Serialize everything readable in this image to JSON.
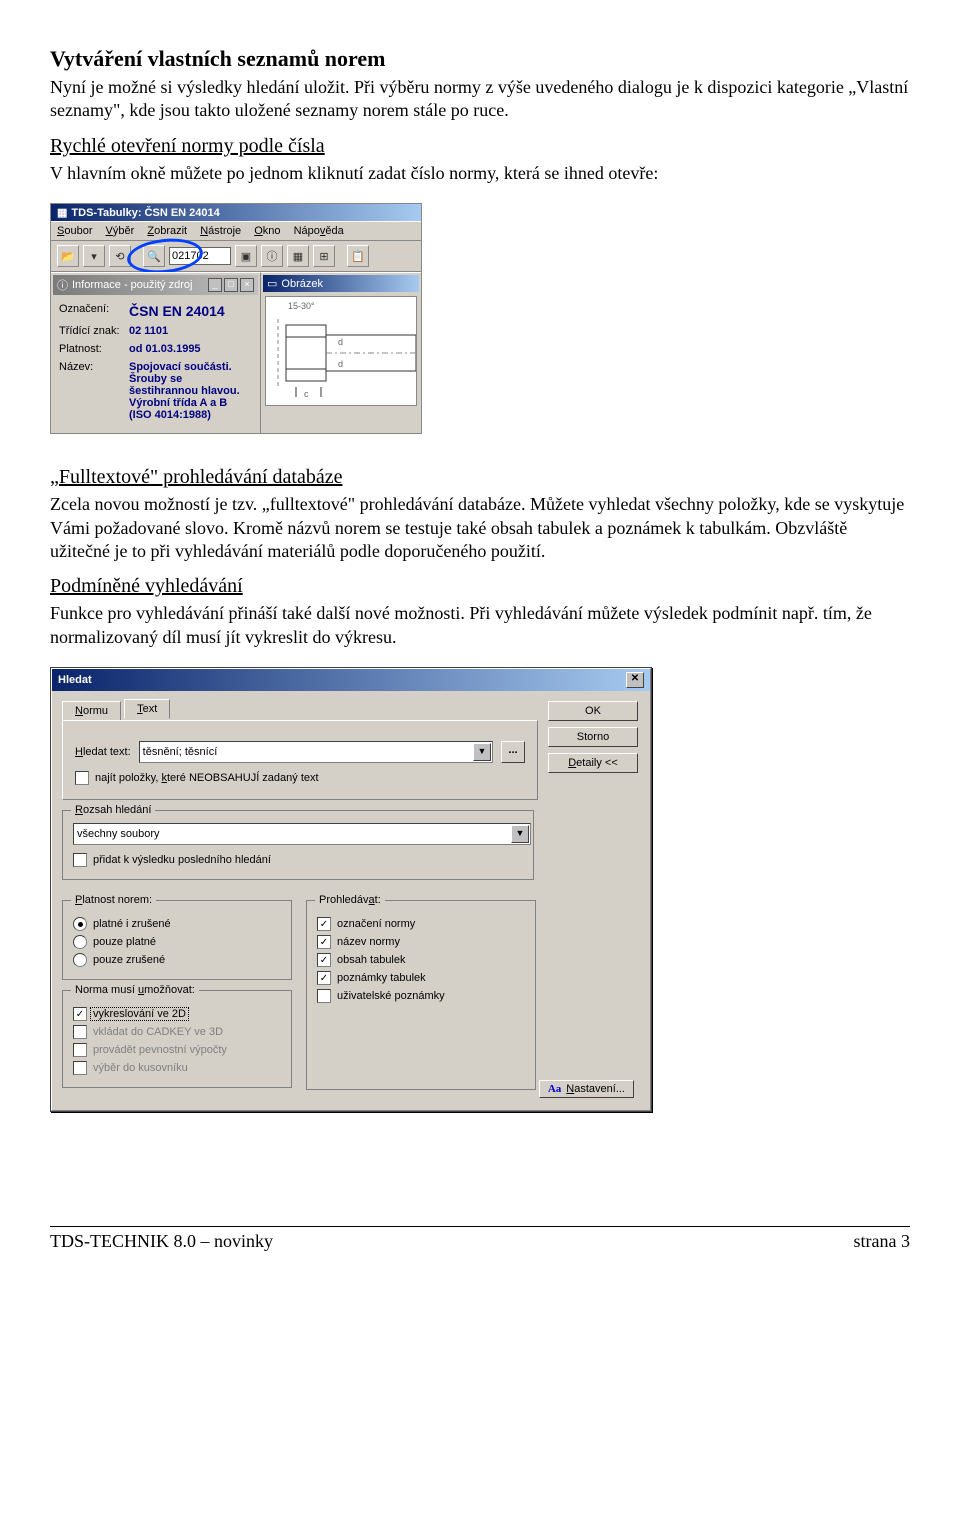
{
  "sections": {
    "s1_heading": "Vytváření vlastních seznamů norem",
    "s1_para": "Nyní je možné si výsledky hledání uložit. Při výběru normy z výše uvedeného dialogu je k dispozici kategorie „Vlastní seznamy\", kde jsou takto uložené seznamy norem stále po ruce.",
    "s2_heading": "Rychlé otevření normy podle čísla",
    "s2_para": "V hlavním okně můžete po jednom kliknutí zadat číslo normy, která se ihned otevře:",
    "s3_heading": "„Fulltextové\" prohledávání databáze",
    "s3_para": "Zcela novou možností je tzv. „fulltextové\" prohledávání databáze. Můžete vyhledat všechny položky, kde se vyskytuje Vámi požadované slovo. Kromě názvů norem se testuje také obsah tabulek a poznámek k tabulkám. Obzvláště užitečné je to při vyhledávání materiálů podle doporučeného použití.",
    "s4_heading": "Podmíněné vyhledávání",
    "s4_para": "Funkce pro vyhledávání přináší také další nové možnosti. Při vyhledávání můžete výsledek podmínit např. tím, že normalizovaný díl musí jít vykreslit do výkresu."
  },
  "app1": {
    "title": "TDS-Tabulky: ČSN EN 24014",
    "menus": [
      "Soubor",
      "Výběr",
      "Zobrazit",
      "Nástroje",
      "Okno",
      "Nápověda"
    ],
    "search_value": "021702",
    "info_panel_title": "Informace - použitý zdroj",
    "rows": {
      "oznaceni_label": "Označení:",
      "oznaceni": "ČSN EN 24014",
      "tridici_label": "Třídící znak:",
      "tridici": "02 1101",
      "platnost_label": "Platnost:",
      "platnost": "od 01.03.1995",
      "nazev_label": "Název:",
      "nazev": "Spojovací součásti. Šrouby se šestihrannou hlavou. Výrobní třída A a B (ISO 4014:1988)"
    },
    "img_panel_title": "Obrázek",
    "angle_label": "15-30°"
  },
  "dlg": {
    "title": "Hledat",
    "tabs": {
      "normu": "Normu",
      "text": "Text"
    },
    "btn_ok": "OK",
    "btn_storno": "Storno",
    "btn_detaily": "Detaily <<",
    "hledat_label": "Hledat text:",
    "hledat_value": "těsnění; těsnící",
    "neobsahuji": "najít položky, které NEOBSAHUJÍ zadaný text",
    "grp_rozsah": "Rozsah hledání",
    "rozsah_value": "všechny soubory",
    "pridat_vysledek": "přidat k výsledku posledního hledání",
    "grp_platnost": "Platnost norem:",
    "radio1": "platné i zrušené",
    "radio2": "pouze platné",
    "radio3": "pouze zrušené",
    "grp_prohledavat": "Prohledávat:",
    "chk_p1": "označení normy",
    "chk_p2": "název normy",
    "chk_p3": "obsah tabulek",
    "chk_p4": "poznámky tabulek",
    "chk_p5": "uživatelské poznámky",
    "grp_norma": "Norma musí umožňovat:",
    "chk_n1": "vykreslování ve 2D",
    "chk_n2": "vkládat do CADKEY ve 3D",
    "chk_n3": "provádět pevnostní výpočty",
    "chk_n4": "výběr do kusovníku",
    "nastaveni": "Nastavení...",
    "aa": "Aa"
  },
  "footer": {
    "left": "TDS-TECHNIK 8.0 – novinky",
    "right": "strana 3"
  }
}
